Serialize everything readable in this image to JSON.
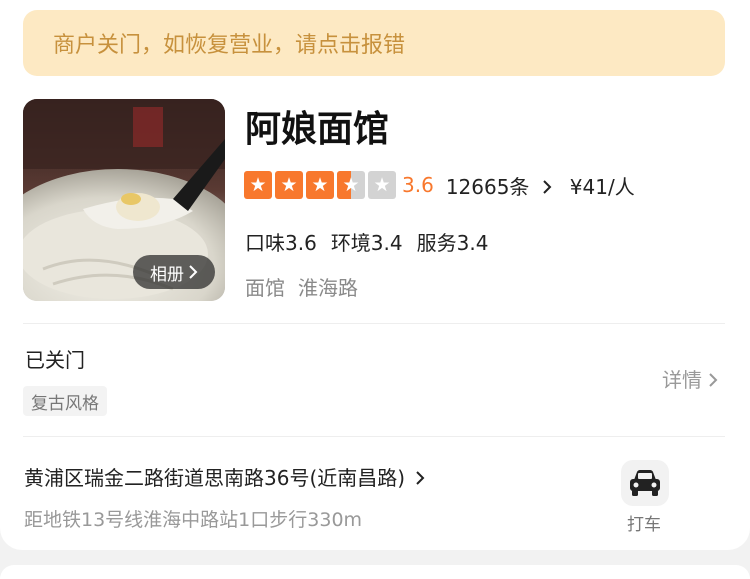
{
  "notice": {
    "text": "商户关门，如恢复营业，请点击报错"
  },
  "shop": {
    "name": "阿娘面馆",
    "album_label": "相册",
    "rating": 3.6,
    "score_text": "3.6",
    "review_count": "12665条",
    "price": "¥41/人",
    "sub_scores": {
      "taste": "口味3.6",
      "environment": "环境3.4",
      "service": "服务3.4"
    },
    "category": "面馆",
    "area": "淮海路"
  },
  "status": {
    "text": "已关门",
    "tag": "复古风格",
    "detail_label": "详情"
  },
  "location": {
    "address": "黄浦区瑞金二路街道思南路36号(近南昌路)",
    "distance": "距地铁13号线淮海中路站1口步行330m",
    "taxi_label": "打车"
  },
  "colors": {
    "accent": "#f8782d",
    "notice_bg": "#fde9c3",
    "notice_text": "#c7913d"
  },
  "icons": {
    "album": "chevron-right-icon",
    "taxi": "car-icon",
    "star": "star-icon"
  }
}
